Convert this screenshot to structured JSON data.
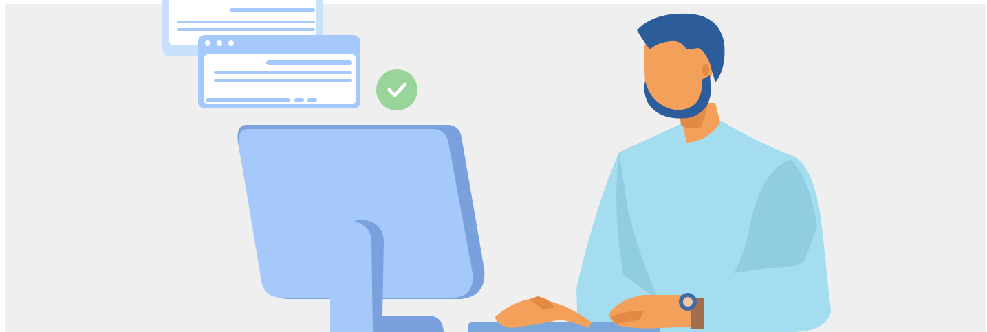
{
  "illustration": {
    "subject": "person-working-at-computer",
    "icons": [
      "browser-window-icon",
      "check-circle-icon",
      "monitor-icon",
      "keyboard-icon",
      "wristwatch-icon"
    ],
    "colors": {
      "page_background": "#ffffff",
      "panel_background": "#efefef",
      "monitor_face": "#a6c9fb",
      "monitor_shadow": "#7aa1db",
      "window_frame": "#a6c9fb",
      "window_back_frame": "#c8e2fb",
      "window_lines": "#a6c9fb",
      "check_badge": "#99d59b",
      "hair_beard": "#2d5c9a",
      "skin": "#f3a05b",
      "skin_shadow": "#e28a45",
      "shirt": "#a4ddf0",
      "shirt_shadow": "#90cde1",
      "keyboard": "#79a6db",
      "watch_band": "#a36e4b",
      "watch_face": "#3e6aa8"
    }
  }
}
